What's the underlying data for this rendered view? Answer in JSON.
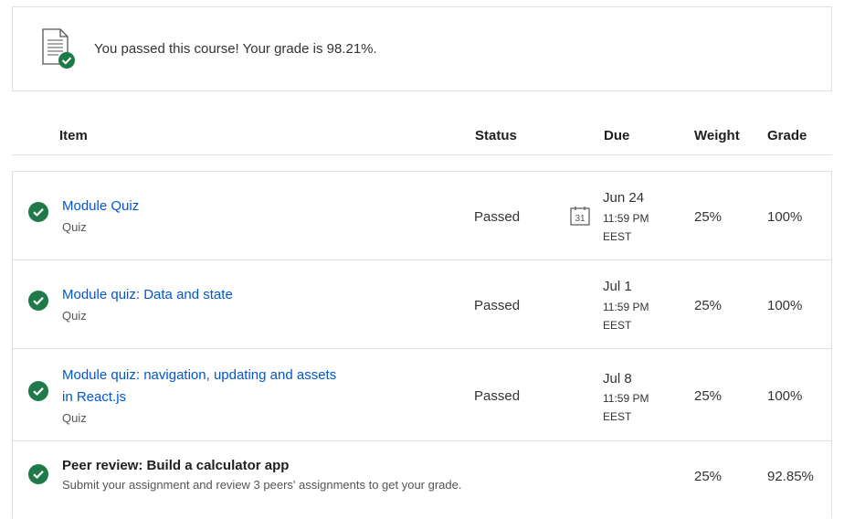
{
  "banner": {
    "icon": "document-check-icon",
    "message": "You passed this course! Your grade is 98.21%."
  },
  "table": {
    "headers": {
      "item": "Item",
      "status": "Status",
      "due": "Due",
      "weight": "Weight",
      "grade": "Grade"
    },
    "rows": [
      {
        "title": "Module Quiz",
        "type": "Quiz",
        "status": "Passed",
        "due_date": "Jun 24",
        "due_time": "11:59 PM",
        "due_tz": "EEST",
        "calendar_day": "31",
        "weight": "25%",
        "grade": "100%"
      },
      {
        "title": "Module quiz: Data and state",
        "type": "Quiz",
        "status": "Passed",
        "due_date": "Jul 1",
        "due_time": "11:59 PM",
        "due_tz": "EEST",
        "weight": "25%",
        "grade": "100%"
      },
      {
        "title_line1": "Module quiz: navigation, updating and assets",
        "title_line2": "in React.js",
        "type": "Quiz",
        "status": "Passed",
        "due_date": "Jul 8",
        "due_time": "11:59 PM",
        "due_tz": "EEST",
        "weight": "25%",
        "grade": "100%"
      },
      {
        "title": "Peer review: Build a calculator app",
        "description": "Submit your assignment and review 3 peers' assignments to get your grade.",
        "weight": "25%",
        "grade": "92.85%"
      }
    ]
  },
  "colors": {
    "check_green": "#1f7a4a",
    "link_blue": "#0056d2",
    "border": "#e1e1e1"
  }
}
